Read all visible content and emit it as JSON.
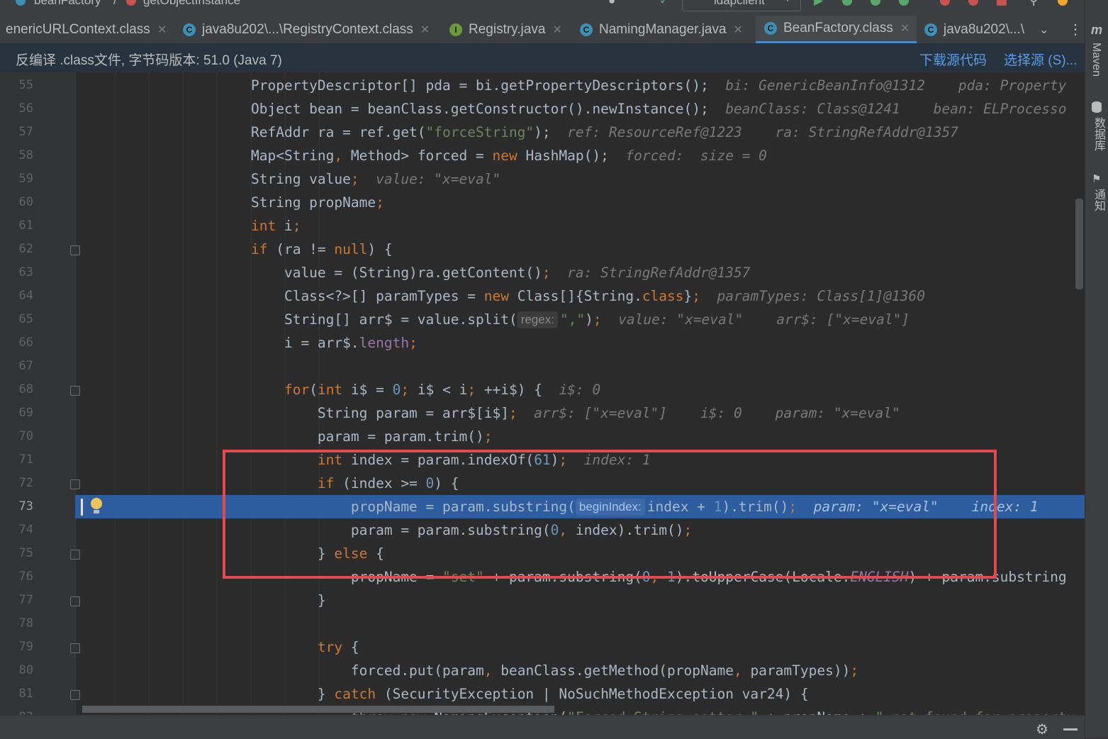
{
  "breadcrumb": {
    "item1": "beanFactory",
    "item2": "getObjectInstance"
  },
  "toolbar": {
    "run_config": "ldapclient"
  },
  "tabs": [
    {
      "label": "enericURLContext.class",
      "icon": "class-icon"
    },
    {
      "label": "java8u202\\...\\RegistryContext.class",
      "icon": "class-icon"
    },
    {
      "label": "Registry.java",
      "icon": "interface-icon"
    },
    {
      "label": "NamingManager.java",
      "icon": "class-icon"
    },
    {
      "label": "BeanFactory.class",
      "icon": "class-icon"
    },
    {
      "label": "java8u202\\...\\",
      "icon": "class-icon"
    }
  ],
  "infobar": {
    "message": "反编译 .class文件, 字节码版本: 51.0 (Java 7)",
    "download_link": "下载源代码",
    "choose_source_link": "选择源 (S)..."
  },
  "right_sidebar": {
    "maven": "Maven",
    "database": "数据库",
    "notifications": "通知"
  },
  "editor": {
    "highlighted_line": "73",
    "lines": [
      {
        "n": "55",
        "html": "PropertyDescriptor[] pda = bi.getPropertyDescriptors();  <span class=\"hint\">bi: GenericBeanInfo@1312    pda: Property</span>"
      },
      {
        "n": "56",
        "html": "Object bean = beanClass.getConstructor().newInstance();  <span class=\"hint\">beanClass: Class@1241    bean: ELProcesso</span>"
      },
      {
        "n": "57",
        "html": "RefAddr ra = ref.get(<span class=\"str\">\"forceString\"</span>);  <span class=\"hint\">ref: ResourceRef@1223    ra: StringRefAddr@1357</span>"
      },
      {
        "n": "58",
        "html": "Map&lt;String<span class=\"kw\">,</span> Method&gt; forced = <span class=\"kw\">new</span> HashMap();  <span class=\"hint\">forced:  size = 0</span>"
      },
      {
        "n": "59",
        "html": "String value<span class=\"kw\">;</span>  <span class=\"hint\">value: \"x=eval\"</span>"
      },
      {
        "n": "60",
        "html": "String propName<span class=\"kw\">;</span>"
      },
      {
        "n": "61",
        "html": "<span class=\"kw\">int</span> i<span class=\"kw\">;</span>"
      },
      {
        "n": "62",
        "html": "<span class=\"kw\">if</span> (ra != <span class=\"kw\">null</span>) {"
      },
      {
        "n": "63",
        "html": "    value = (String)ra.getContent()<span class=\"kw\">;</span>  <span class=\"hint\">ra: StringRefAddr@1357</span>"
      },
      {
        "n": "64",
        "html": "    Class&lt;?&gt;[] paramTypes = <span class=\"kw\">new</span> Class[]{String.<span class=\"kw\">class</span>}<span class=\"kw\">;</span>  <span class=\"hint\">paramTypes: Class[1]@1360</span>"
      },
      {
        "n": "65",
        "html": "    String[] arr$ = value.split(<span class=\"pname\">regex:</span><span class=\"str\">\",\"</span>)<span class=\"kw\">;</span>  <span class=\"hint\">value: \"x=eval\"    arr$: [\"x=eval\"]</span>"
      },
      {
        "n": "66",
        "html": "    i = arr$.<span class=\"fld\">length</span><span class=\"kw\">;</span>"
      },
      {
        "n": "67",
        "html": ""
      },
      {
        "n": "68",
        "html": "    <span class=\"kw\">for</span>(<span class=\"kw\">int</span> i$ = <span class=\"numlit\">0</span><span class=\"kw\">;</span> i$ &lt; i<span class=\"kw\">;</span> ++i$) {  <span class=\"hint\">i$: 0</span>"
      },
      {
        "n": "69",
        "html": "        String param = arr$[i$]<span class=\"kw\">;</span>  <span class=\"hint\">arr$: [\"x=eval\"]    i$: 0    param: \"x=eval\"</span>"
      },
      {
        "n": "70",
        "html": "        param = param.trim()<span class=\"kw\">;</span>"
      },
      {
        "n": "71",
        "html": "        <span class=\"kw\">int</span> index = param.indexOf(<span class=\"numlit\">61</span>)<span class=\"kw\">;</span>  <span class=\"hint\">index: 1</span>"
      },
      {
        "n": "72",
        "html": "        <span class=\"kw\">if</span> (index &gt;= <span class=\"numlit\">0</span>) {"
      },
      {
        "n": "73",
        "html": "            propName = param.substring(<span class=\"pname\">beginIndex:</span>index + <span class=\"numlit\">1</span>).trim()<span class=\"kw\">;</span>  <span class=\"hint\">param: \"x=eval\"    index: 1</span>"
      },
      {
        "n": "74",
        "html": "            param = param.substring(<span class=\"numlit\">0</span><span class=\"kw\">,</span> index).trim()<span class=\"kw\">;</span>"
      },
      {
        "n": "75",
        "html": "        } <span class=\"kw\">else</span> {"
      },
      {
        "n": "76",
        "html": "            propName = <span class=\"str\">\"set\"</span> + param.substring(<span class=\"numlit\">0</span><span class=\"kw\">,</span> <span class=\"numlit\">1</span>).toUpperCase(Locale.<span class=\"field-it\">ENGLISH</span>) + param.substring"
      },
      {
        "n": "77",
        "html": "        }"
      },
      {
        "n": "78",
        "html": ""
      },
      {
        "n": "79",
        "html": "        <span class=\"kw\">try</span> {"
      },
      {
        "n": "80",
        "html": "            forced.put(param<span class=\"kw\">,</span> beanClass.getMethod(propName<span class=\"kw\">,</span> paramTypes))<span class=\"kw\">;</span>"
      },
      {
        "n": "81",
        "html": "        } <span class=\"kw\">catch</span> (SecurityException | NoSuchMethodException var24) {"
      },
      {
        "n": "82",
        "html": "            <span class=\"kw\">throw new</span> NamingException(<span class=\"str\">\"Forced String setter \"</span> + propName + <span class=\"str\">\" not found for property \"</span> + param)"
      }
    ]
  }
}
